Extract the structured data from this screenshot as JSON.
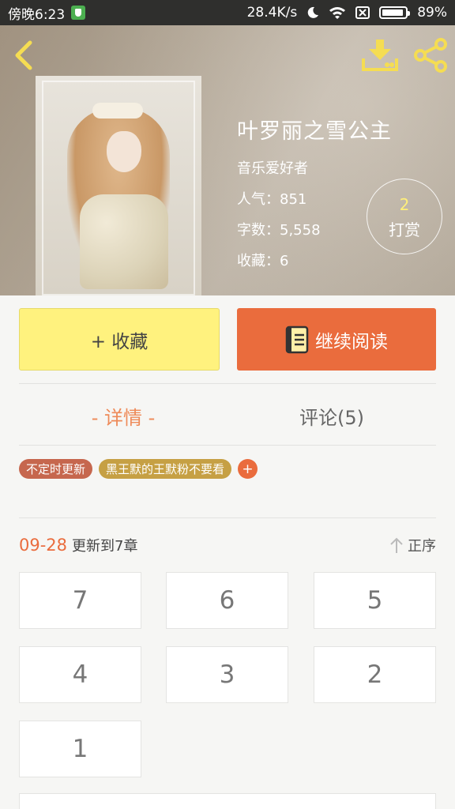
{
  "status_bar": {
    "time": "傍晚6:23",
    "network_speed": "28.4K/s",
    "battery": "89%"
  },
  "book": {
    "title": "叶罗丽之雪公主",
    "author": "音乐爱好者",
    "popularity": "人气：851",
    "word_count": "字数：5,558",
    "favorites": "收藏：6"
  },
  "reward": {
    "count": "2",
    "label": "打赏"
  },
  "actions": {
    "collect_label": "+ 收藏",
    "read_label": "继续阅读"
  },
  "tabs": {
    "details": "- 详情 -",
    "comments": "评论(5)"
  },
  "tags": [
    "不定时更新",
    "黑王默的王默粉不要看",
    "+"
  ],
  "update": {
    "date": "09-28",
    "text": "更新到7章",
    "sort_label": "正序"
  },
  "chapters": [
    "7",
    "6",
    "5",
    "4",
    "3",
    "2",
    "1"
  ],
  "colors": {
    "accent": "#ea6c3d",
    "collect": "#fff27e",
    "tab_active": "#ee8a58"
  },
  "icons": [
    "back-icon",
    "download-icon",
    "share-icon",
    "book-icon",
    "sort-up-icon"
  ]
}
